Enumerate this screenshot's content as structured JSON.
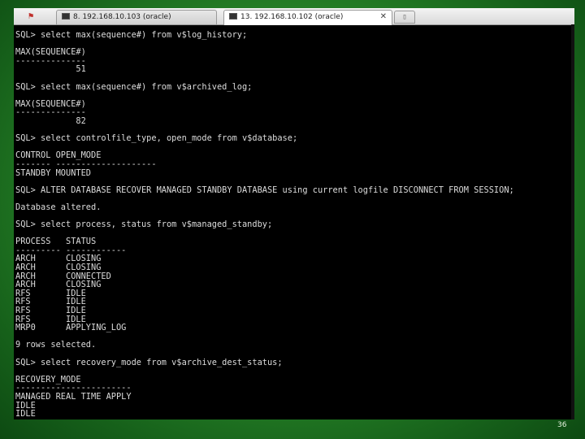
{
  "tabs": [
    {
      "label": "8. 192.168.10.103 (oracle)",
      "active": false
    },
    {
      "label": "13. 192.168.10.102 (oracle)",
      "active": true
    }
  ],
  "terminal_lines": [
    "SQL> select max(sequence#) from v$log_history;",
    "",
    "MAX(SEQUENCE#)",
    "--------------",
    "            51",
    "",
    "SQL> select max(sequence#) from v$archived_log;",
    "",
    "MAX(SEQUENCE#)",
    "--------------",
    "            82",
    "",
    "SQL> select controlfile_type, open_mode from v$database;",
    "",
    "CONTROL OPEN_MODE",
    "------- --------------------",
    "STANDBY MOUNTED",
    "",
    "SQL> ALTER DATABASE RECOVER MANAGED STANDBY DATABASE using current logfile DISCONNECT FROM SESSION;",
    "",
    "Database altered.",
    "",
    "SQL> select process, status from v$managed_standby;",
    "",
    "PROCESS   STATUS",
    "--------- ------------",
    "ARCH      CLOSING",
    "ARCH      CLOSING",
    "ARCH      CONNECTED",
    "ARCH      CLOSING",
    "RFS       IDLE",
    "RFS       IDLE",
    "RFS       IDLE",
    "RFS       IDLE",
    "MRP0      APPLYING_LOG",
    "",
    "9 rows selected.",
    "",
    "SQL> select recovery_mode from v$archive_dest_status;",
    "",
    "RECOVERY_MODE",
    "-----------------------",
    "MANAGED REAL TIME APPLY",
    "IDLE",
    "IDLE"
  ],
  "page_number": "36"
}
